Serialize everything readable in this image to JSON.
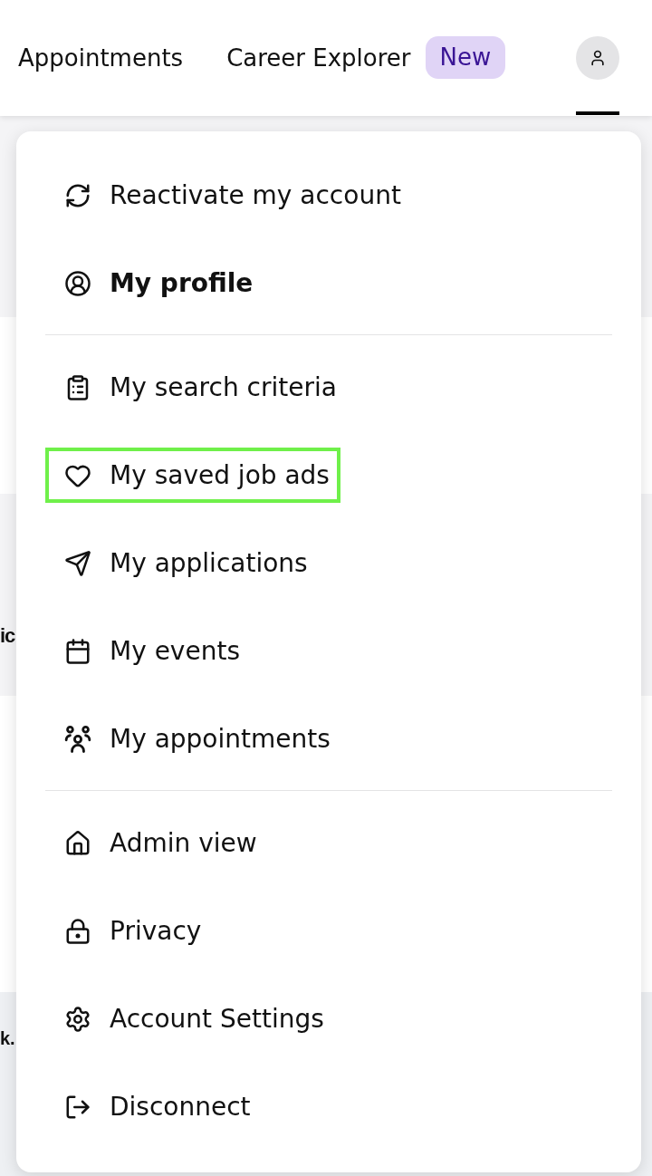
{
  "nav": {
    "links": [
      {
        "label": "Appointments",
        "selected": false
      },
      {
        "label": "Career Explorer",
        "selected": false,
        "badge": "New"
      }
    ],
    "account": {
      "selected": true
    }
  },
  "page_behind": {
    "texts": [
      "ic",
      "k."
    ]
  },
  "menu": {
    "sections": [
      {
        "items": [
          {
            "label": "Reactivate my account",
            "selected": false,
            "focused": false
          },
          {
            "label": "My profile",
            "selected": true,
            "focused": false
          }
        ]
      },
      {
        "items": [
          {
            "label": "My search criteria",
            "selected": false,
            "focused": false
          },
          {
            "label": "My saved job ads",
            "selected": false,
            "focused": true
          },
          {
            "label": "My applications",
            "selected": false,
            "focused": false
          },
          {
            "label": "My events",
            "selected": false,
            "focused": false
          },
          {
            "label": "My appointments",
            "selected": false,
            "focused": false
          }
        ]
      },
      {
        "items": [
          {
            "label": "Admin view",
            "selected": false,
            "focused": false
          },
          {
            "label": "Privacy",
            "selected": false,
            "focused": false
          },
          {
            "label": "Account Settings",
            "selected": false,
            "focused": false
          },
          {
            "label": "Disconnect",
            "selected": false,
            "focused": false
          }
        ]
      }
    ]
  }
}
